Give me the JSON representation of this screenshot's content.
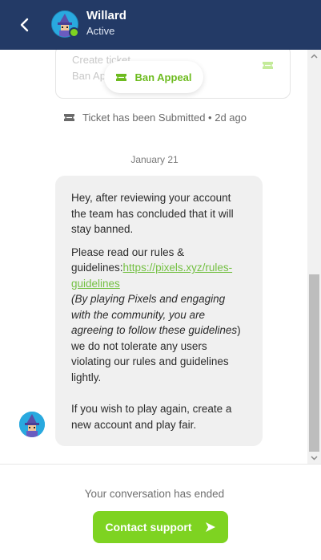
{
  "header": {
    "name": "Willard",
    "status": "Active",
    "icons": {
      "back": "chevron-left-icon",
      "online": "online-status-dot"
    }
  },
  "ticket_card": {
    "line1": "Create ticket",
    "line2": "Ban Ap",
    "icon": "ticket-icon"
  },
  "ban_appeal_pill": {
    "label": "Ban Appeal",
    "icon": "ticket-icon"
  },
  "submitted": {
    "text": "Ticket has been Submitted • 2d ago",
    "icon": "ticket-icon"
  },
  "date_separator": "January 21",
  "message": {
    "p1": "Hey, after reviewing your account the team has concluded that it will stay banned.",
    "p2_prefix": "Please read our rules & guidelines:",
    "link": "https://pixels.xyz/rules-guidelines",
    "italic": "(By playing Pixels and engaging with the community, you are agreeing to follow these guidelines",
    "p2_suffix": ") we do not tolerate any users violating our rules and guidelines lightly.",
    "p3": "If you wish to play again, create a new account and play fair."
  },
  "footer": {
    "ended_text": "Your conversation has ended",
    "contact_label": "Contact support",
    "contact_icon": "send-icon"
  },
  "colors": {
    "header_bg": "#233a66",
    "accent_green": "#7ed321",
    "link_green": "#74c043",
    "bubble_bg": "#f0f0f0"
  }
}
